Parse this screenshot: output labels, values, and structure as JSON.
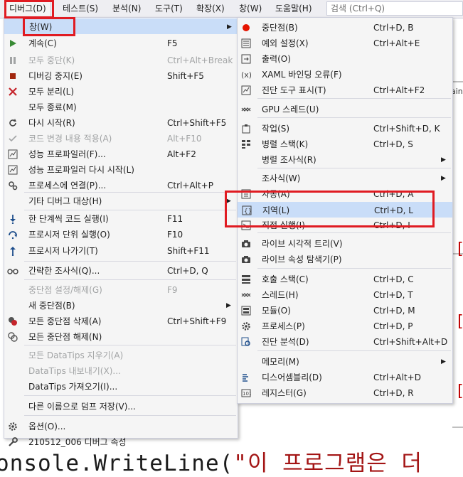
{
  "menubar": {
    "items": [
      {
        "label": "디버그(D)"
      },
      {
        "label": "테스트(S)"
      },
      {
        "label": "분석(N)"
      },
      {
        "label": "도구(T)"
      },
      {
        "label": "확장(X)"
      },
      {
        "label": "창(W)"
      },
      {
        "label": "도움말(H)"
      }
    ],
    "search_placeholder": "검색 (Ctrl+Q)"
  },
  "editor": {
    "code_prefix": "onsole.WriteLine(",
    "code_string": "\"이 프로그램은 더",
    "right_word": "ain",
    "right_brackets": [
      "[",
      "[",
      "["
    ]
  },
  "debug_menu": {
    "items": [
      {
        "label": "창(W)",
        "shortcut": "",
        "icon": "none",
        "submenu": true,
        "disabled": false
      },
      {
        "label": "계속(C)",
        "shortcut": "F5",
        "icon": "play-icon",
        "disabled": false
      },
      {
        "label": "모두 중단(K)",
        "shortcut": "Ctrl+Alt+Break",
        "icon": "pause-icon",
        "disabled": true
      },
      {
        "label": "디버깅 중지(E)",
        "shortcut": "Shift+F5",
        "icon": "stop-icon",
        "disabled": false
      },
      {
        "label": "모두 분리(L)",
        "shortcut": "",
        "icon": "detach-icon",
        "disabled": false
      },
      {
        "label": "모두 종료(M)",
        "shortcut": "",
        "icon": "none",
        "disabled": false
      },
      {
        "label": "다시 시작(R)",
        "shortcut": "Ctrl+Shift+F5",
        "icon": "restart-icon",
        "disabled": false
      },
      {
        "label": "코드 변경 내용 적용(A)",
        "shortcut": "Alt+F10",
        "icon": "apply-code-changes-icon",
        "disabled": true
      },
      {
        "label": "성능 프로파일러(F)...",
        "shortcut": "Alt+F2",
        "icon": "profiler-icon",
        "disabled": false
      },
      {
        "label": "성능 프로파일러 다시 시작(L)",
        "shortcut": "",
        "icon": "profiler-restart-icon",
        "disabled": false
      },
      {
        "label": "프로세스에 연결(P)...",
        "shortcut": "Ctrl+Alt+P",
        "icon": "attach-process-icon",
        "disabled": false
      },
      {
        "label": "기타 디버그 대상(H)",
        "shortcut": "",
        "icon": "none",
        "submenu": true,
        "disabled": false
      },
      {
        "label": "한 단계씩 코드 실행(I)",
        "shortcut": "F11",
        "icon": "step-into-icon",
        "disabled": false
      },
      {
        "label": "프로시저 단위 실행(O)",
        "shortcut": "F10",
        "icon": "step-over-icon",
        "disabled": false
      },
      {
        "label": "프로시저 나가기(T)",
        "shortcut": "Shift+F11",
        "icon": "step-out-icon",
        "disabled": false
      },
      {
        "label": "간략한 조사식(Q)...",
        "shortcut": "Ctrl+D, Q",
        "icon": "quickwatch-icon",
        "disabled": false
      },
      {
        "label": "중단점 설정/해제(G)",
        "shortcut": "F9",
        "icon": "none",
        "disabled": true
      },
      {
        "label": "새 중단점(B)",
        "shortcut": "",
        "icon": "none",
        "submenu": true,
        "disabled": false
      },
      {
        "label": "모든 중단점 삭제(A)",
        "shortcut": "Ctrl+Shift+F9",
        "icon": "delete-breakpoints-icon",
        "disabled": false
      },
      {
        "label": "모든 중단점 해제(N)",
        "shortcut": "",
        "icon": "disable-breakpoints-icon",
        "disabled": false
      },
      {
        "label": "모든 DataTips 지우기(A)",
        "shortcut": "",
        "icon": "none",
        "disabled": true
      },
      {
        "label": "DataTips 내보내기(X)...",
        "shortcut": "",
        "icon": "none",
        "disabled": true
      },
      {
        "label": "DataTips 가져오기(I)...",
        "shortcut": "",
        "icon": "none",
        "disabled": false
      },
      {
        "label": "다른 이름으로 덤프 저장(V)...",
        "shortcut": "",
        "icon": "none",
        "disabled": false
      },
      {
        "label": "옵션(O)...",
        "shortcut": "",
        "icon": "gear-icon",
        "disabled": false
      },
      {
        "label": "210512_006 디버그 속성",
        "shortcut": "",
        "icon": "wrench-icon",
        "disabled": false
      }
    ]
  },
  "window_submenu": {
    "items": [
      {
        "label": "중단점(B)",
        "shortcut": "Ctrl+D, B",
        "icon": "breakpoint-icon"
      },
      {
        "label": "예외 설정(X)",
        "shortcut": "Ctrl+Alt+E",
        "icon": "exception-settings-icon"
      },
      {
        "label": "출력(O)",
        "shortcut": "",
        "icon": "output-icon"
      },
      {
        "label": "XAML 바인딩 오류(F)",
        "shortcut": "",
        "icon": "xaml-binding-icon"
      },
      {
        "label": "진단 도구 표시(T)",
        "shortcut": "Ctrl+Alt+F2",
        "icon": "diagnostic-tools-icon"
      },
      {
        "label": "GPU 스레드(U)",
        "shortcut": "",
        "icon": "gpu-threads-icon"
      },
      {
        "label": "작업(S)",
        "shortcut": "Ctrl+Shift+D, K",
        "icon": "tasks-icon"
      },
      {
        "label": "병렬 스택(K)",
        "shortcut": "Ctrl+D, S",
        "icon": "parallel-stacks-icon"
      },
      {
        "label": "병렬 조사식(R)",
        "shortcut": "",
        "icon": "none",
        "submenu": true
      },
      {
        "label": "조사식(W)",
        "shortcut": "",
        "icon": "none",
        "submenu": true
      },
      {
        "label": "자동(A)",
        "shortcut": "Ctrl+D, A",
        "icon": "autos-icon"
      },
      {
        "label": "지역(L)",
        "shortcut": "Ctrl+D, L",
        "icon": "locals-icon"
      },
      {
        "label": "직접 실행(I)",
        "shortcut": "Ctrl+D, I",
        "icon": "immediate-icon"
      },
      {
        "label": "라이브 시각적 트리(V)",
        "shortcut": "",
        "icon": "live-visual-tree-icon"
      },
      {
        "label": "라이브 속성 탐색기(P)",
        "shortcut": "",
        "icon": "live-property-explorer-icon"
      },
      {
        "label": "호출 스택(C)",
        "shortcut": "Ctrl+D, C",
        "icon": "call-stack-icon"
      },
      {
        "label": "스레드(H)",
        "shortcut": "Ctrl+D, T",
        "icon": "threads-icon"
      },
      {
        "label": "모듈(O)",
        "shortcut": "Ctrl+D, M",
        "icon": "modules-icon"
      },
      {
        "label": "프로세스(P)",
        "shortcut": "Ctrl+D, P",
        "icon": "processes-icon"
      },
      {
        "label": "진단 분석(D)",
        "shortcut": "Ctrl+Shift+Alt+D",
        "icon": "diagnostic-analysis-icon"
      },
      {
        "label": "메모리(M)",
        "shortcut": "",
        "icon": "none",
        "submenu": true
      },
      {
        "label": "디스어셈블리(D)",
        "shortcut": "Ctrl+Alt+D",
        "icon": "disassembly-icon"
      },
      {
        "label": "레지스터(G)",
        "shortcut": "Ctrl+D, R",
        "icon": "registers-icon"
      }
    ]
  },
  "colors": {
    "highlight": "#c9ddf8",
    "annotation_red": "#e01b22",
    "play_green": "#388a34",
    "stop_red": "#a1260d"
  }
}
